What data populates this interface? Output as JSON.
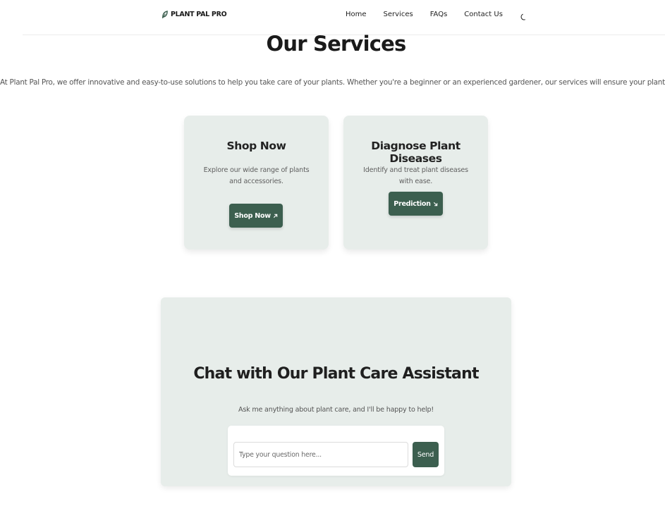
{
  "header": {
    "brand": "PLANT PAL PRO",
    "nav": [
      "Home",
      "Services",
      "FAQs",
      "Contact Us"
    ],
    "theme_icon": "moon-icon"
  },
  "services": {
    "title": "Our Services",
    "description": "At Plant Pal Pro, we offer innovative and easy-to-use solutions to help you take care of your plants. Whether you're a beginner or an experienced gardener, our services will ensure your plants thrive.",
    "cards": [
      {
        "title": "Shop Now",
        "description": "Explore our wide range of plants and accessories.",
        "button": "Shop Now",
        "button_icon": "arrow-up-right-icon"
      },
      {
        "title": "Diagnose Plant Diseases",
        "description": "Identify and treat plant diseases with ease.",
        "button": "Prediction",
        "button_icon": "arrow-down-right-icon"
      }
    ]
  },
  "chat": {
    "title": "Chat with Our Plant Care Assistant",
    "subtitle": "Ask me anything about plant care, and I'll be happy to help!",
    "input_value": "",
    "placeholder": "Type your question here...",
    "send_label": "Send"
  },
  "colors": {
    "accent": "#3c5f4f",
    "card_bg": "#e7edea",
    "text": "#1f1f1f"
  }
}
